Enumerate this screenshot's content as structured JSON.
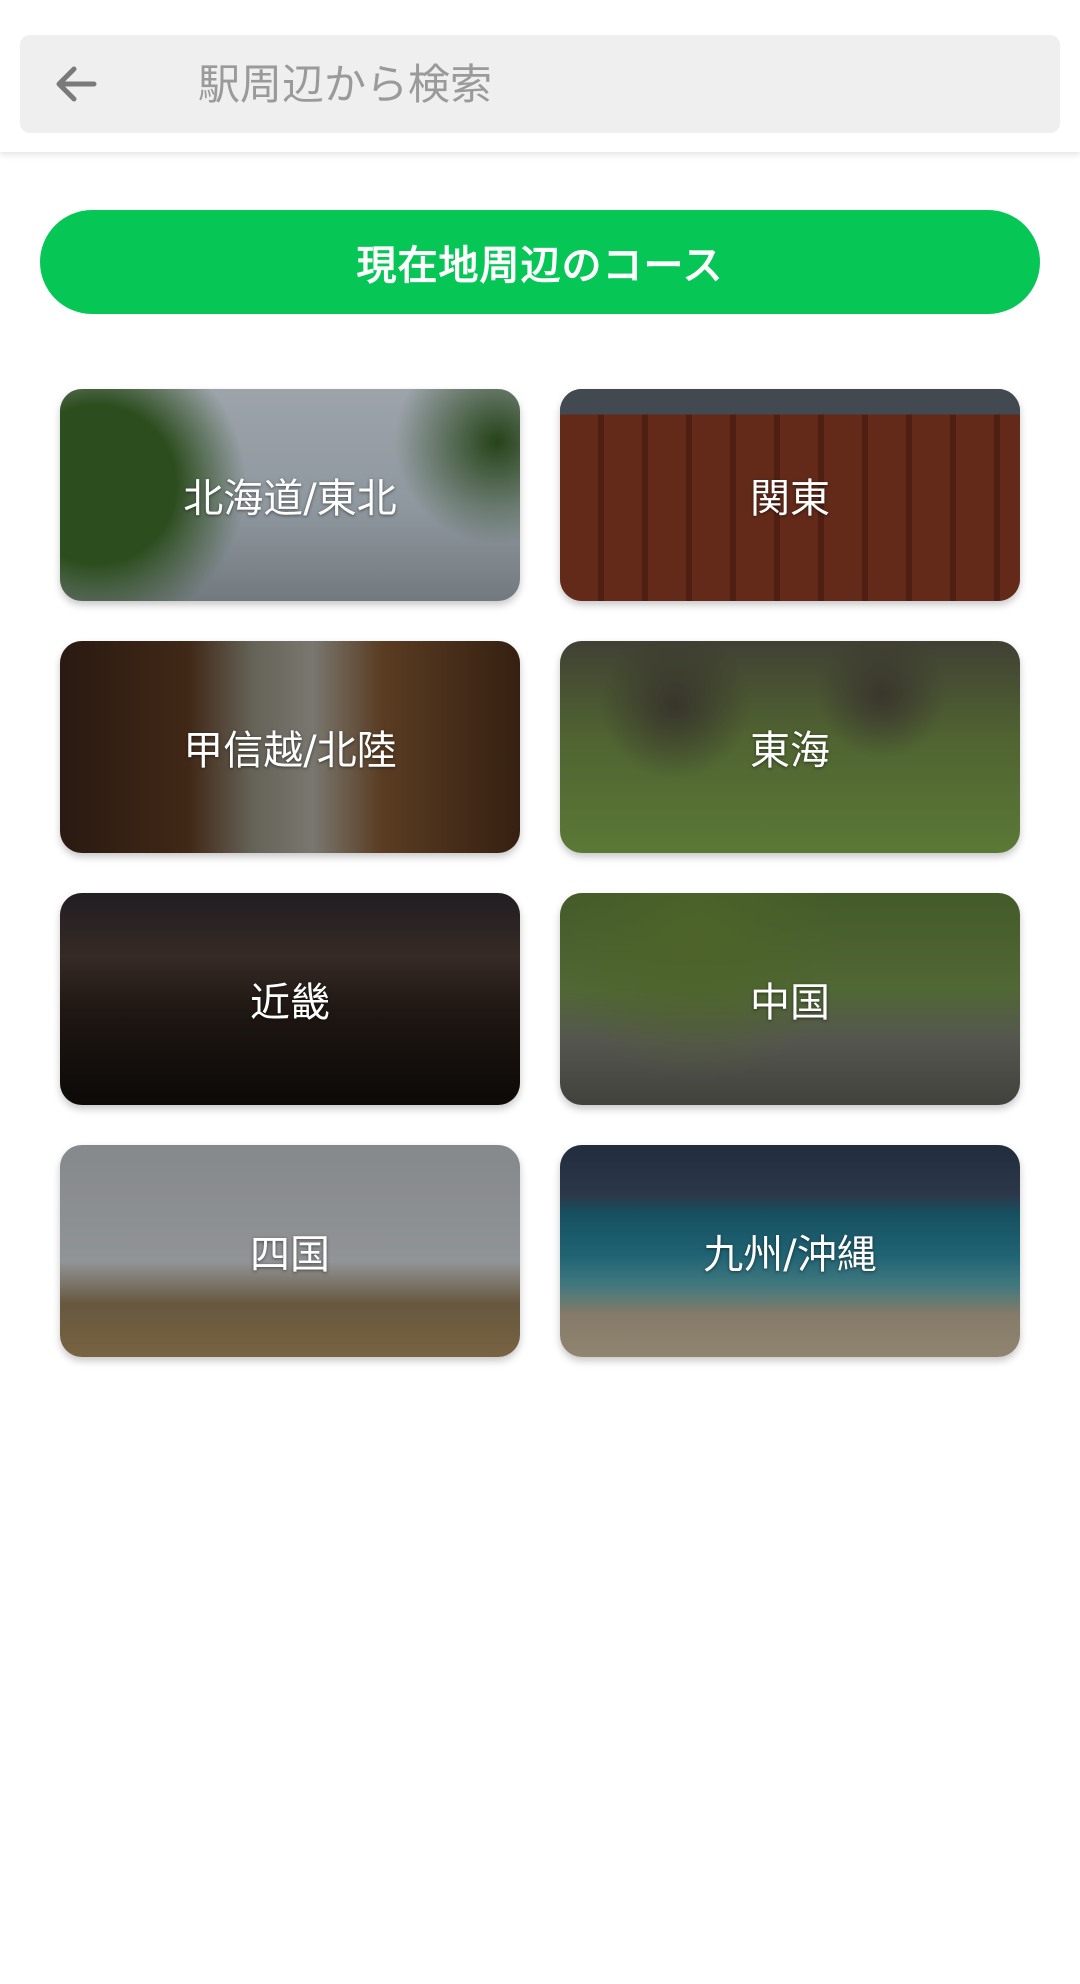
{
  "search": {
    "placeholder": "駅周辺から検索",
    "value": ""
  },
  "nearby_button": {
    "label": "現在地周辺のコース",
    "color": "#06c755"
  },
  "regions": [
    {
      "label": "北海道/東北"
    },
    {
      "label": "関東"
    },
    {
      "label": "甲信越/北陸"
    },
    {
      "label": "東海"
    },
    {
      "label": "近畿"
    },
    {
      "label": "中国"
    },
    {
      "label": "四国"
    },
    {
      "label": "九州/沖縄"
    }
  ]
}
